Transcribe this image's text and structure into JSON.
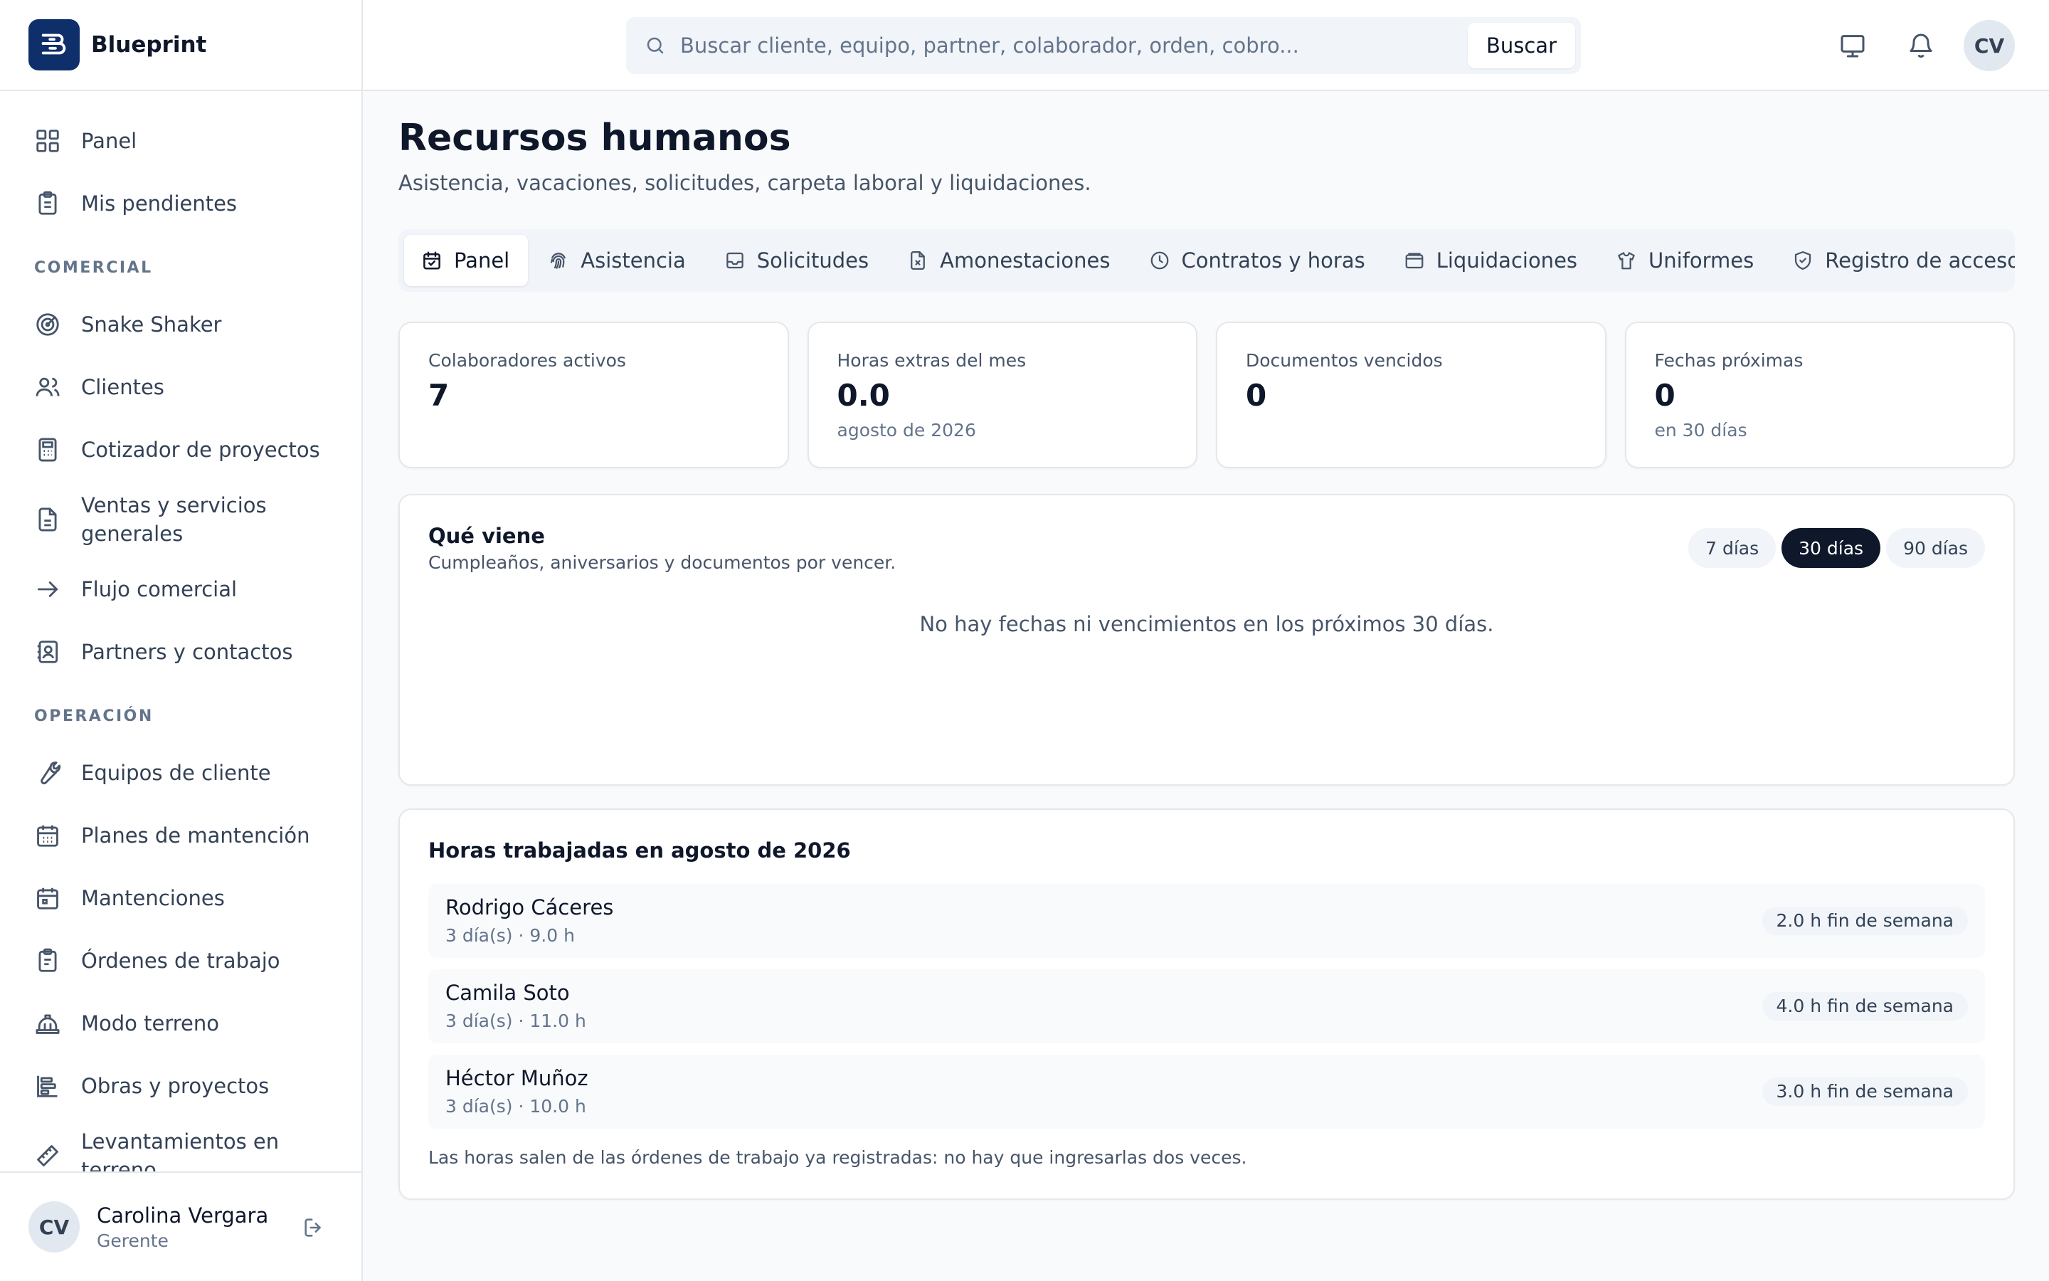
{
  "brand": {
    "name": "Blueprint"
  },
  "sidebar": {
    "top_items": [
      {
        "label": "Panel",
        "icon": "grid-icon"
      },
      {
        "label": "Mis pendientes",
        "icon": "clipboard-icon"
      }
    ],
    "sections": [
      {
        "title": "COMERCIAL",
        "items": [
          {
            "label": "Snake Shaker",
            "icon": "target-icon"
          },
          {
            "label": "Clientes",
            "icon": "users-icon"
          },
          {
            "label": "Cotizador de proyectos",
            "icon": "calculator-icon"
          },
          {
            "label": "Ventas y servicios generales",
            "icon": "file-icon"
          },
          {
            "label": "Flujo comercial",
            "icon": "arrow-right-icon"
          },
          {
            "label": "Partners y contactos",
            "icon": "contact-icon"
          }
        ]
      },
      {
        "title": "OPERACIÓN",
        "items": [
          {
            "label": "Equipos de cliente",
            "icon": "wrench-icon"
          },
          {
            "label": "Planes de mantención",
            "icon": "calendar-grid-icon"
          },
          {
            "label": "Mantenciones",
            "icon": "calendar-icon"
          },
          {
            "label": "Órdenes de trabajo",
            "icon": "clipboard-list-icon"
          },
          {
            "label": "Modo terreno",
            "icon": "hard-hat-icon"
          },
          {
            "label": "Obras y proyectos",
            "icon": "gantt-icon"
          },
          {
            "label": "Levantamientos en terreno",
            "icon": "ruler-icon"
          }
        ]
      }
    ]
  },
  "user": {
    "initials": "CV",
    "name": "Carolina Vergara",
    "role": "Gerente"
  },
  "search": {
    "placeholder": "Buscar cliente, equipo, partner, colaborador, orden, cobro...",
    "button_label": "Buscar"
  },
  "topbar": {
    "avatar_initials": "CV"
  },
  "page": {
    "title": "Recursos humanos",
    "subtitle": "Asistencia, vacaciones, solicitudes, carpeta laboral y liquidaciones."
  },
  "tabs": [
    {
      "label": "Panel",
      "icon": "calendar-check-icon",
      "active": true
    },
    {
      "label": "Asistencia",
      "icon": "fingerprint-icon",
      "active": false
    },
    {
      "label": "Solicitudes",
      "icon": "inbox-icon",
      "active": false
    },
    {
      "label": "Amonestaciones",
      "icon": "file-x-icon",
      "active": false
    },
    {
      "label": "Contratos y horas",
      "icon": "clock-icon",
      "active": false
    },
    {
      "label": "Liquidaciones",
      "icon": "wallet-icon",
      "active": false
    },
    {
      "label": "Uniformes",
      "icon": "shirt-icon",
      "active": false
    },
    {
      "label": "Registro de accesos",
      "icon": "shield-icon",
      "active": false
    }
  ],
  "stats": [
    {
      "label": "Colaboradores activos",
      "value": "7",
      "sub": ""
    },
    {
      "label": "Horas extras del mes",
      "value": "0.0",
      "sub": "agosto de 2026"
    },
    {
      "label": "Documentos vencidos",
      "value": "0",
      "sub": ""
    },
    {
      "label": "Fechas próximas",
      "value": "0",
      "sub": "en 30 días"
    }
  ],
  "upcoming": {
    "title": "Qué viene",
    "subtitle": "Cumpleaños, aniversarios y documentos por vencer.",
    "ranges": [
      {
        "label": "7 días",
        "active": false
      },
      {
        "label": "30 días",
        "active": true
      },
      {
        "label": "90 días",
        "active": false
      }
    ],
    "empty_message": "No hay fechas ni vencimientos en los próximos 30 días."
  },
  "hours": {
    "title": "Horas trabajadas en agosto de 2026",
    "rows": [
      {
        "name": "Rodrigo Cáceres",
        "meta": "3 día(s) · 9.0 h",
        "badge": "2.0 h fin de semana"
      },
      {
        "name": "Camila Soto",
        "meta": "3 día(s) · 11.0 h",
        "badge": "4.0 h fin de semana"
      },
      {
        "name": "Héctor Muñoz",
        "meta": "3 día(s) · 10.0 h",
        "badge": "3.0 h fin de semana"
      }
    ],
    "footnote": "Las horas salen de las órdenes de trabajo ya registradas: no hay que ingresarlas dos veces."
  }
}
